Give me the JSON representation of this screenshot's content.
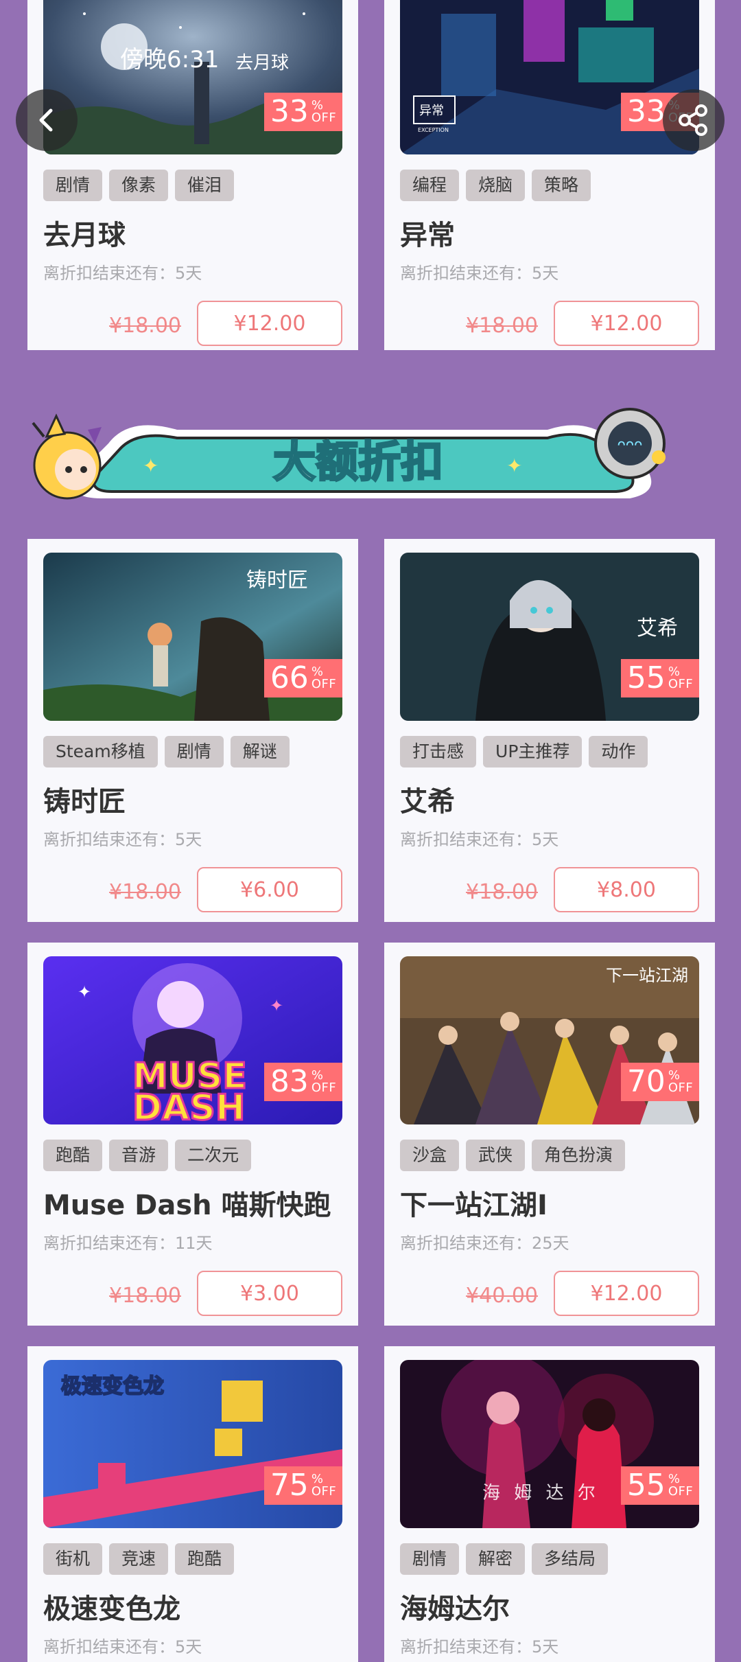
{
  "banner": {
    "title": "大额折扣"
  },
  "cards": [
    {
      "title": "去月球",
      "tags": [
        "剧情",
        "像素",
        "催泪"
      ],
      "discount": "33",
      "remain": "离折扣结束还有：5天",
      "original_price": "¥18.00",
      "price": "¥12.00",
      "art_text": "傍晚6:31",
      "art_text2": "去月球"
    },
    {
      "title": "异常",
      "tags": [
        "编程",
        "烧脑",
        "策略"
      ],
      "discount": "33",
      "remain": "离折扣结束还有：5天",
      "original_price": "¥18.00",
      "price": "¥12.00",
      "art_text": "异常",
      "art_text2": "EXCEPTION"
    },
    {
      "title": "铸时匠",
      "tags": [
        "Steam移植",
        "剧情",
        "解谜"
      ],
      "discount": "66",
      "remain": "离折扣结束还有：5天",
      "original_price": "¥18.00",
      "price": "¥6.00",
      "art_text": "铸时匠"
    },
    {
      "title": "艾希",
      "tags": [
        "打击感",
        "UP主推荐",
        "动作"
      ],
      "discount": "55",
      "remain": "离折扣结束还有：5天",
      "original_price": "¥18.00",
      "price": "¥8.00",
      "art_text": "艾希"
    },
    {
      "title": "Muse Dash 喵斯快跑",
      "tags": [
        "跑酷",
        "音游",
        "二次元"
      ],
      "discount": "83",
      "remain": "离折扣结束还有：11天",
      "original_price": "¥18.00",
      "price": "¥3.00",
      "art_text": "MUSE",
      "art_text2": "DASH"
    },
    {
      "title": "下一站江湖Ⅰ",
      "tags": [
        "沙盒",
        "武侠",
        "角色扮演"
      ],
      "discount": "70",
      "remain": "离折扣结束还有：25天",
      "original_price": "¥40.00",
      "price": "¥12.00",
      "art_text": "下一站江湖"
    },
    {
      "title": "极速变色龙",
      "tags": [
        "街机",
        "竞速",
        "跑酷"
      ],
      "discount": "75",
      "remain": "离折扣结束还有：5天",
      "art_text": "极速变色龙"
    },
    {
      "title": "海姆达尔",
      "tags": [
        "剧情",
        "解密",
        "多结局"
      ],
      "discount": "55",
      "remain": "离折扣结束还有：5天",
      "art_text": "海 姆 达 尔"
    }
  ],
  "discount_suffix": {
    "percent": "%",
    "off": "OFF"
  },
  "colors": {
    "background": "#9470b4",
    "accent": "#ff6f73",
    "price_border": "#f09396"
  },
  "icons": {
    "back": "chevron-left-icon",
    "share": "share-icon"
  }
}
